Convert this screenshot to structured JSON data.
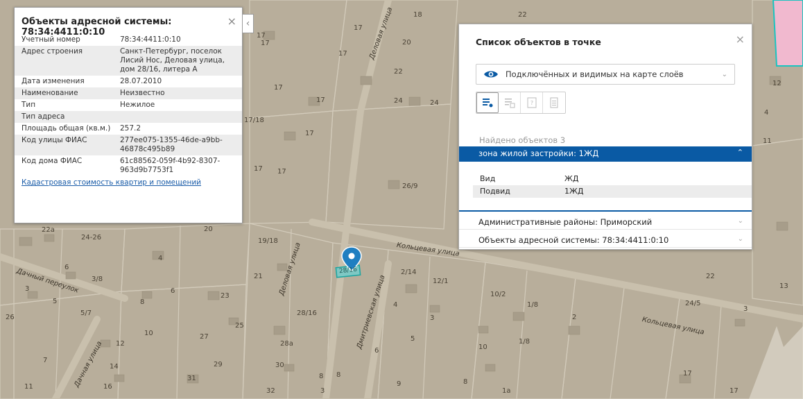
{
  "left_panel": {
    "title": "Объекты адресной системы: 78:34:4411:0:10",
    "close_glyph": "×",
    "collapse_glyph": "‹",
    "rows": [
      {
        "k": "Учетный номер",
        "v": "78:34:4411:0:10"
      },
      {
        "k": "Адрес строения",
        "v": "Санкт-Петербург, поселок Лисий Нос, Деловая улица, дом 28/16, литера А"
      },
      {
        "k": "Дата изменения",
        "v": "28.07.2010"
      },
      {
        "k": "Наименование",
        "v": "Неизвестно"
      },
      {
        "k": "Тип",
        "v": "Нежилое"
      },
      {
        "k": "Тип адреса",
        "v": ""
      },
      {
        "k": "Площадь общая (кв.м.)",
        "v": "257.2"
      },
      {
        "k": "Код улицы ФИАС",
        "v": "277ee075-1355-46de-a9bb-46878c495b89"
      },
      {
        "k": "Код дома ФИАС",
        "v": "61c88562-059f-4b92-8307-963d9b7753f1"
      }
    ],
    "link": "Кадастровая стоимость квартир и помещений"
  },
  "right_panel": {
    "title": "Список объектов в точке",
    "close_glyph": "×",
    "layer_select": "Подключённых и видимых на карте слоёв",
    "found": "Найдено объектов 3",
    "active_section": "зона жилой застройки: 1ЖД",
    "details": [
      {
        "k": "Вид",
        "v": "ЖД"
      },
      {
        "k": "Подвид",
        "v": "1ЖД"
      }
    ],
    "sections": [
      "Административные районы: Приморский",
      "Объекты адресной системы: 78:34:4411:0:10"
    ]
  },
  "map": {
    "marker_label": "28/16",
    "streets": [
      {
        "text": "Деловая улица",
        "a": -70
      },
      {
        "text": "Деловая улица",
        "a": -72
      },
      {
        "text": "Кольцевая улица",
        "a": 8
      },
      {
        "text": "Кольцевая улица",
        "a": 12
      },
      {
        "text": "Дачный переулок",
        "a": 18
      },
      {
        "text": "Дачная улица",
        "a": -62
      },
      {
        "text": "Дмитриевская улица",
        "a": -72
      }
    ],
    "house_numbers": [
      "17",
      "18",
      "20",
      "22",
      "17",
      "17",
      "22",
      "24",
      "24",
      "17",
      "17",
      "17/18",
      "17",
      "26/9",
      "17",
      "17",
      "17",
      "22a",
      "24-26",
      "20",
      "19/18",
      "4",
      "6",
      "3/8",
      "21",
      "5",
      "3",
      "5/7",
      "8",
      "6",
      "23",
      "26",
      "28/16",
      "25",
      "2/14",
      "12/1",
      "4",
      "3",
      "10/2",
      "1/8",
      "24/5",
      "2",
      "3",
      "22",
      "13",
      "12",
      "10",
      "27",
      "28a",
      "5",
      "6",
      "1/8",
      "14",
      "29",
      "30",
      "7",
      "31",
      "32",
      "8",
      "3",
      "9",
      "8",
      "1a",
      "17",
      "17",
      "11",
      "16",
      "8",
      "10",
      "12",
      "4",
      "11"
    ]
  }
}
